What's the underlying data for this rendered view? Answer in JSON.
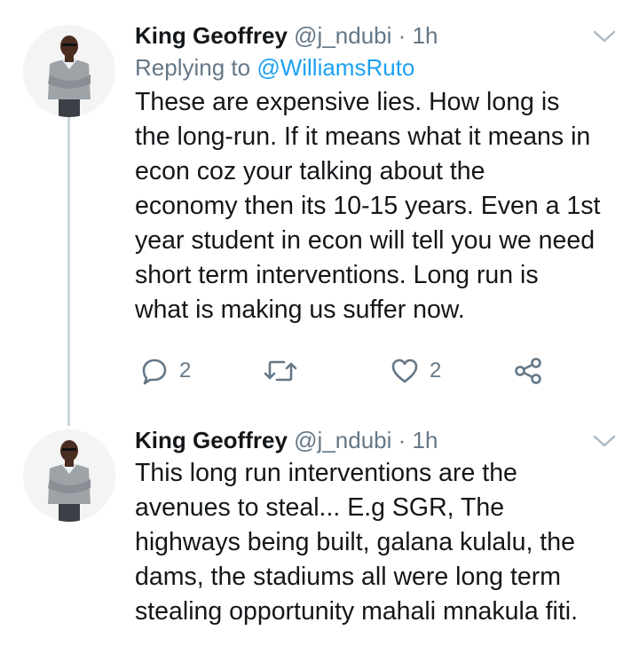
{
  "tweets": [
    {
      "author": {
        "name": "King Geoffrey",
        "handle": "@j_ndubi"
      },
      "separator": "·",
      "time": "1h",
      "reply_prefix": "Replying to ",
      "reply_to": "@WilliamsRuto",
      "lines": [
        "These are expensive lies. How long is",
        "the long-run. If it means what it means in",
        "econ coz your talking about the",
        "economy then its 10-15 years. Even a 1st",
        "year student in econ will tell you we need",
        "short term interventions. Long run is",
        "what is making us suffer now."
      ],
      "actions": {
        "replies": "2",
        "likes": "2"
      }
    },
    {
      "author": {
        "name": "King Geoffrey",
        "handle": "@j_ndubi"
      },
      "separator": "·",
      "time": "1h",
      "lines": [
        "This long run interventions are the",
        "avenues to steal... E.g SGR, The",
        "highways being built, galana kulalu, the",
        "dams, the stadiums all were long term",
        "stealing opportunity mahali mnakula fiti."
      ]
    }
  ],
  "icons": {
    "reply": "reply-icon",
    "retweet": "retweet-icon",
    "like": "heart-icon",
    "share": "share-icon",
    "menu": "chevron-down-icon"
  },
  "colors": {
    "text": "#14171a",
    "secondary": "#657786",
    "link": "#1da1f2",
    "thread_line": "#ccd6dd"
  }
}
